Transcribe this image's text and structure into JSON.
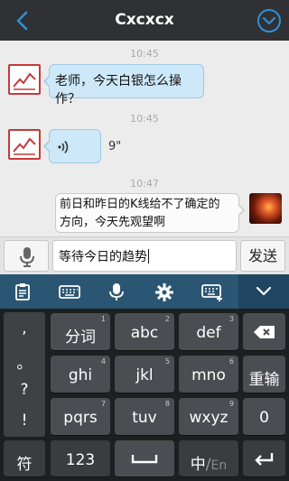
{
  "header": {
    "title": "Cxcxcx"
  },
  "messages": [
    {
      "time": "10:45",
      "text": "老师，今天白银怎么操作？"
    },
    {
      "time": "10:45",
      "voice_duration": "9\""
    },
    {
      "time": "10:47",
      "text_line1": "前日和昨日的K线给不了确定的",
      "text_line2": "方向，今天先观望啊"
    }
  ],
  "input": {
    "value": "等待今日的趋势",
    "send_label": "发送"
  },
  "keyboard": {
    "side": [
      ",",
      "。",
      "?",
      "!"
    ],
    "row1": [
      {
        "label": "分词",
        "num": "1"
      },
      {
        "label": "abc",
        "num": "2"
      },
      {
        "label": "def",
        "num": "3"
      }
    ],
    "row2": [
      {
        "label": "ghi",
        "num": "4"
      },
      {
        "label": "jkl",
        "num": "5"
      },
      {
        "label": "mno",
        "num": "6"
      },
      {
        "label": "重输"
      }
    ],
    "row3": [
      {
        "label": "pqrs",
        "num": "7"
      },
      {
        "label": "tuv",
        "num": "8"
      },
      {
        "label": "wxyz",
        "num": "9"
      },
      {
        "label": "0"
      }
    ],
    "row4": {
      "symbol": "符",
      "numbers": "123",
      "lang_zh": "中",
      "lang_sep": "/",
      "lang_en": "En"
    }
  },
  "colors": {
    "header_bg": "#303134",
    "accent": "#2f8fd8",
    "bubble_left": "#cde8f8",
    "toolbar_bg": "#2b5673",
    "keyboard_bg": "#1d1f21"
  },
  "icons": {
    "back": "back-arrow-icon",
    "menu": "chevron-down-circle-icon",
    "avatar": "trend-chart-icon",
    "voice": "voice-wave-icon",
    "mic": "microphone-icon",
    "clipboard": "clipboard-icon",
    "keyboard": "keyboard-icon",
    "settings": "gear-icon",
    "edit": "keyboard-edit-icon",
    "collapse": "chevron-down-icon",
    "backspace": "backspace-icon",
    "space": "space-icon",
    "enter": "enter-icon"
  }
}
